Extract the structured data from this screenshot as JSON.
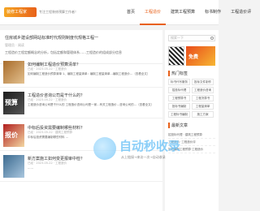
{
  "header": {
    "logo_text": "装修工程家",
    "tagline": "专注工程装修预算工作者！",
    "nav": [
      {
        "label": "首页",
        "active": false
      },
      {
        "label": "工程造价",
        "active": true
      },
      {
        "label": "建筑工程预算",
        "active": false
      },
      {
        "label": "标书制作",
        "active": false
      },
      {
        "label": "工程造价评",
        "active": false
      }
    ]
  },
  "featured": {
    "title": "住房城乡建设部网站标准时代规则制度代规格工程一",
    "meta": "管理员 · 阅读",
    "excerpt": "工程造价工程定额概念的分析，包括定额和管理体系……工程造价的组成部分信息"
  },
  "posts": [
    {
      "title": "如何编制工程造价预算清单？",
      "meta": "已经 · 2023-05-22 · 工程造价",
      "excerpt": "如何编制工程造价预算清单 1、编制工程量清单：编制工程量清单…编制工程造价…（查看全文）"
    },
    {
      "title": "工程造价咨询公司是干什么的？",
      "meta": "已经 · 2023-05-22 · 工程造价",
      "excerpt": "工程造价咨询公司是干什么的 工程造价咨询公司是一家…有关工程造价…咨询公司的…（查看全文）"
    },
    {
      "title": "中标后投资需要编制哪些材料？",
      "meta": "已经 · 2023-05-22 · 建筑工程预算",
      "excerpt": "中标后投资需要编制哪些材料 …"
    },
    {
      "title": "新方案施工如何变更报审中检？",
      "meta": "已经 · 2023-05-22 · 工程造价",
      "excerpt": "……"
    }
  ],
  "sidebar": {
    "search_placeholder": "搜索一下",
    "promo_text": "免费",
    "section_tags_title": "热门标签",
    "tags": [
      "标书代写服务",
      "投标文件制作",
      "招投标代理",
      "工程造价咨询",
      "工程预算书",
      "工程决算书",
      "投标书编制",
      "工程量清单",
      "工程标书编制",
      "施工方案"
    ],
    "section_list_title": "最新文章",
    "list": [
      "招投标代理 · 建筑工程预算",
      "工程造价 ·工程造价评",
      "如何编制工程预算·工程造价"
    ]
  },
  "watermark": {
    "text": "自动秒收录",
    "sub": "从上链接→来访一次→自动收录"
  }
}
